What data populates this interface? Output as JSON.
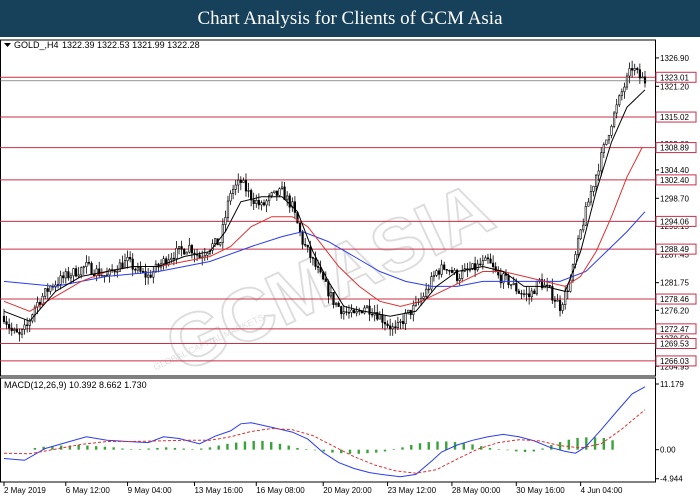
{
  "banner": {
    "title": "Chart Analysis for Clients of GCM Asia"
  },
  "watermark": {
    "main": "GCMASIA",
    "sub": "GLOBAL CAPITAL MARKETS"
  },
  "colors": {
    "bull_candle": "#000000",
    "bear_candle": "#000000",
    "ma_fast": "#000000",
    "ma_mid": "#e03030",
    "ma_slow": "#2a3cf0",
    "level_line": "#c8304a",
    "macd_line": "#2a3cf0",
    "signal_line": "#e03030",
    "histogram": "#3aa23a",
    "banner_bg": "#17405a"
  },
  "chart_data": [
    {
      "type": "candlestick",
      "symbol_label": "GOLD_,H4",
      "ohlc_label": "1322.39 1322.53 1321.99 1322.28",
      "ylim": [
        1263.0,
        1330.5
      ],
      "y_ticks": [
        "1326.90",
        "1321.20",
        "1315.02",
        "1309.60",
        "1304.40",
        "1298.70",
        "1293.15",
        "1287.45",
        "1281.75",
        "1276.20",
        "1270.50",
        "1264.95"
      ],
      "levels": [
        {
          "price": 1323.01,
          "label": "1323.01"
        },
        {
          "price": 1315.02,
          "label": "1315.02"
        },
        {
          "price": 1308.89,
          "label": "1308.89"
        },
        {
          "price": 1302.4,
          "label": "1302.40"
        },
        {
          "price": 1294.06,
          "label": "1294.06"
        },
        {
          "price": 1288.49,
          "label": "1288.49"
        },
        {
          "price": 1278.46,
          "label": "1278.46"
        },
        {
          "price": 1272.47,
          "label": "1272.47"
        },
        {
          "price": 1269.53,
          "label": "1269.53"
        },
        {
          "price": 1266.03,
          "label": "1266.03"
        }
      ],
      "close_path": [
        [
          0,
          1275
        ],
        [
          3,
          1272
        ],
        [
          6,
          1271
        ],
        [
          9,
          1273
        ],
        [
          12,
          1277
        ],
        [
          15,
          1279
        ],
        [
          18,
          1281
        ],
        [
          21,
          1282
        ],
        [
          24,
          1283
        ],
        [
          28,
          1284
        ],
        [
          32,
          1285
        ],
        [
          36,
          1284
        ],
        [
          40,
          1283
        ],
        [
          44,
          1285
        ],
        [
          48,
          1286
        ],
        [
          52,
          1284
        ],
        [
          56,
          1283
        ],
        [
          60,
          1285
        ],
        [
          64,
          1287
        ],
        [
          68,
          1288
        ],
        [
          72,
          1289
        ],
        [
          76,
          1287
        ],
        [
          80,
          1289
        ],
        [
          84,
          1290
        ],
        [
          88,
          1300
        ],
        [
          92,
          1302
        ],
        [
          96,
          1299
        ],
        [
          100,
          1297
        ],
        [
          104,
          1299
        ],
        [
          108,
          1300
        ],
        [
          112,
          1297
        ],
        [
          116,
          1290
        ],
        [
          120,
          1286
        ],
        [
          124,
          1282
        ],
        [
          128,
          1278
        ],
        [
          132,
          1276
        ],
        [
          136,
          1275
        ],
        [
          140,
          1277
        ],
        [
          144,
          1276
        ],
        [
          148,
          1274
        ],
        [
          152,
          1272
        ],
        [
          156,
          1275
        ],
        [
          160,
          1277
        ],
        [
          164,
          1280
        ],
        [
          168,
          1284
        ],
        [
          172,
          1285
        ],
        [
          176,
          1283
        ],
        [
          180,
          1284
        ],
        [
          184,
          1285
        ],
        [
          188,
          1286
        ],
        [
          192,
          1283
        ],
        [
          196,
          1282
        ],
        [
          200,
          1280
        ],
        [
          204,
          1279
        ],
        [
          208,
          1282
        ],
        [
          212,
          1280
        ],
        [
          216,
          1277
        ],
        [
          220,
          1282
        ],
        [
          224,
          1292
        ],
        [
          228,
          1300
        ],
        [
          232,
          1307
        ],
        [
          236,
          1314
        ],
        [
          240,
          1320
        ],
        [
          244,
          1325
        ],
        [
          247,
          1323
        ],
        [
          249,
          1322.3
        ]
      ],
      "ma_fast_path": [
        [
          0,
          1276
        ],
        [
          10,
          1274
        ],
        [
          20,
          1280
        ],
        [
          30,
          1283
        ],
        [
          40,
          1284
        ],
        [
          50,
          1285
        ],
        [
          60,
          1285
        ],
        [
          70,
          1287
        ],
        [
          80,
          1288
        ],
        [
          86,
          1292
        ],
        [
          92,
          1298
        ],
        [
          100,
          1299
        ],
        [
          108,
          1299
        ],
        [
          114,
          1296
        ],
        [
          120,
          1288
        ],
        [
          126,
          1282
        ],
        [
          132,
          1277
        ],
        [
          140,
          1276
        ],
        [
          150,
          1275
        ],
        [
          160,
          1276
        ],
        [
          168,
          1281
        ],
        [
          176,
          1284
        ],
        [
          186,
          1285
        ],
        [
          194,
          1284
        ],
        [
          202,
          1281
        ],
        [
          210,
          1281
        ],
        [
          218,
          1280
        ],
        [
          224,
          1288
        ],
        [
          230,
          1300
        ],
        [
          236,
          1310
        ],
        [
          242,
          1317
        ],
        [
          249,
          1320.5
        ]
      ],
      "ma_mid_path": [
        [
          0,
          1278
        ],
        [
          10,
          1276
        ],
        [
          20,
          1279
        ],
        [
          30,
          1282
        ],
        [
          40,
          1284
        ],
        [
          50,
          1285
        ],
        [
          60,
          1285
        ],
        [
          70,
          1286
        ],
        [
          80,
          1287
        ],
        [
          88,
          1289
        ],
        [
          96,
          1293
        ],
        [
          104,
          1295
        ],
        [
          112,
          1295
        ],
        [
          118,
          1293
        ],
        [
          124,
          1289
        ],
        [
          130,
          1285
        ],
        [
          138,
          1281
        ],
        [
          146,
          1278
        ],
        [
          154,
          1277
        ],
        [
          162,
          1278
        ],
        [
          170,
          1280
        ],
        [
          178,
          1282
        ],
        [
          186,
          1284
        ],
        [
          194,
          1284
        ],
        [
          202,
          1283
        ],
        [
          210,
          1282
        ],
        [
          218,
          1281
        ],
        [
          224,
          1283
        ],
        [
          230,
          1288
        ],
        [
          236,
          1295
        ],
        [
          242,
          1303
        ],
        [
          248,
          1309
        ]
      ],
      "ma_slow_path": [
        [
          0,
          1282
        ],
        [
          20,
          1281
        ],
        [
          40,
          1283
        ],
        [
          60,
          1284
        ],
        [
          80,
          1286
        ],
        [
          96,
          1289
        ],
        [
          108,
          1291
        ],
        [
          116,
          1292
        ],
        [
          126,
          1290
        ],
        [
          136,
          1287
        ],
        [
          146,
          1284
        ],
        [
          156,
          1282
        ],
        [
          166,
          1281
        ],
        [
          176,
          1281
        ],
        [
          186,
          1282
        ],
        [
          196,
          1282
        ],
        [
          206,
          1282
        ],
        [
          216,
          1282
        ],
        [
          226,
          1284
        ],
        [
          234,
          1288
        ],
        [
          242,
          1292
        ],
        [
          249,
          1296
        ]
      ]
    },
    {
      "type": "macd",
      "label": "MACD(12,26,9) 10.392 8.662 1.730",
      "ylim": [
        -5.5,
        12.2
      ],
      "y_ticks": [
        "11.179",
        "0.00",
        "-4.944"
      ],
      "macd_path": [
        [
          0,
          -1.5
        ],
        [
          8,
          -1.8
        ],
        [
          16,
          0.2
        ],
        [
          24,
          1.2
        ],
        [
          32,
          2.2
        ],
        [
          40,
          1.6
        ],
        [
          48,
          1.4
        ],
        [
          56,
          1.2
        ],
        [
          62,
          2.2
        ],
        [
          68,
          1.9
        ],
        [
          76,
          1.0
        ],
        [
          82,
          2.3
        ],
        [
          88,
          3.2
        ],
        [
          92,
          4.4
        ],
        [
          96,
          4.6
        ],
        [
          100,
          4.2
        ],
        [
          106,
          3.6
        ],
        [
          112,
          3.0
        ],
        [
          118,
          1.8
        ],
        [
          124,
          -0.5
        ],
        [
          130,
          -2.2
        ],
        [
          136,
          -3.2
        ],
        [
          142,
          -3.9
        ],
        [
          148,
          -4.3
        ],
        [
          154,
          -4.6
        ],
        [
          160,
          -4.2
        ],
        [
          166,
          -2.0
        ],
        [
          170,
          -0.4
        ],
        [
          176,
          0.8
        ],
        [
          182,
          1.6
        ],
        [
          188,
          2.2
        ],
        [
          194,
          2.6
        ],
        [
          200,
          2.2
        ],
        [
          206,
          1.5
        ],
        [
          212,
          0.4
        ],
        [
          218,
          -0.3
        ],
        [
          222,
          -0.6
        ],
        [
          226,
          0.5
        ],
        [
          232,
          3.4
        ],
        [
          238,
          6.5
        ],
        [
          244,
          9.5
        ],
        [
          249,
          10.7
        ]
      ],
      "signal_path": [
        [
          0,
          -0.6
        ],
        [
          10,
          -0.7
        ],
        [
          20,
          0.1
        ],
        [
          30,
          0.9
        ],
        [
          40,
          1.4
        ],
        [
          50,
          1.4
        ],
        [
          60,
          1.5
        ],
        [
          70,
          1.6
        ],
        [
          80,
          1.6
        ],
        [
          88,
          2.2
        ],
        [
          96,
          3.1
        ],
        [
          104,
          3.6
        ],
        [
          112,
          3.4
        ],
        [
          120,
          2.4
        ],
        [
          128,
          0.6
        ],
        [
          136,
          -1.2
        ],
        [
          144,
          -2.6
        ],
        [
          152,
          -3.6
        ],
        [
          160,
          -4.0
        ],
        [
          168,
          -3.4
        ],
        [
          176,
          -1.6
        ],
        [
          184,
          0.1
        ],
        [
          192,
          1.2
        ],
        [
          200,
          1.7
        ],
        [
          208,
          1.5
        ],
        [
          216,
          0.7
        ],
        [
          224,
          0.3
        ],
        [
          232,
          1.0
        ],
        [
          240,
          3.5
        ],
        [
          249,
          6.8
        ]
      ],
      "histogram_start": 12,
      "histogram": [
        0.3,
        0.5,
        0.6,
        0.7,
        0.7,
        0.8,
        0.7,
        0.6,
        0.5,
        0.4,
        0.2,
        0.1,
        0.1,
        0.2,
        0.3,
        0.4,
        0.3,
        0.2,
        0.1,
        0.2,
        0.4,
        0.7,
        1.0,
        1.2,
        1.4,
        1.5,
        1.5,
        1.3,
        1.0,
        0.7,
        0.3,
        0.1,
        -0.1,
        -0.3,
        -0.5,
        -0.6,
        -0.7,
        -0.7,
        -0.6,
        -0.5,
        -0.3,
        0.1,
        0.4,
        0.8,
        1.1,
        1.3,
        1.4,
        1.4,
        1.3,
        1.1,
        0.9,
        0.6,
        0.3,
        0.1,
        -0.1,
        -0.3,
        -0.4,
        -0.3,
        0.2,
        0.8,
        1.3,
        1.7,
        2.0,
        2.1,
        2.1,
        2.0,
        1.6
      ]
    }
  ],
  "x_axis": {
    "labels": [
      {
        "bar": 0,
        "text": "2 May 2019"
      },
      {
        "bar": 24,
        "text": "6 May 12:00"
      },
      {
        "bar": 48,
        "text": "9 May 04:00"
      },
      {
        "bar": 74,
        "text": "13 May 16:00"
      },
      {
        "bar": 98,
        "text": "16 May 08:00"
      },
      {
        "bar": 124,
        "text": "20 May 20:00"
      },
      {
        "bar": 149,
        "text": "23 May 12:00"
      },
      {
        "bar": 174,
        "text": "28 May 00:00"
      },
      {
        "bar": 199,
        "text": "30 May 16:00"
      },
      {
        "bar": 224,
        "text": "4 Jun 04:00"
      }
    ]
  }
}
